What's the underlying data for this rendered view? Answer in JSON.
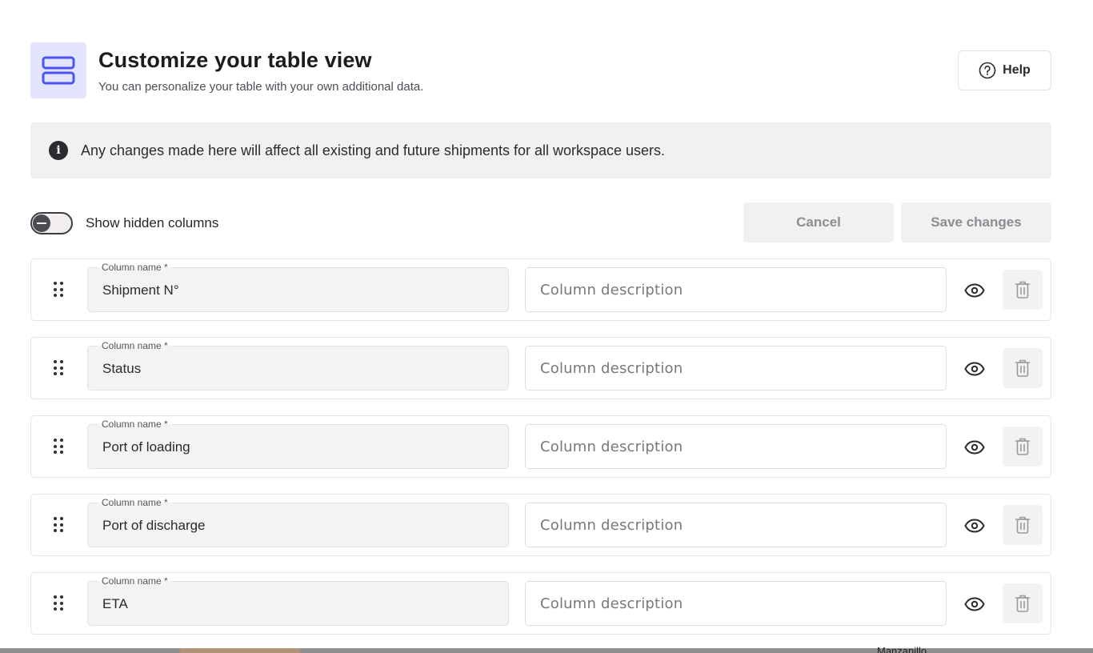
{
  "header": {
    "title": "Customize your table view",
    "subtitle": "You can personalize your table with your own additional data.",
    "icon": "table-rows-icon",
    "help_label": "Help"
  },
  "banner": {
    "icon": "info-icon",
    "icon_glyph": "i",
    "text": "Any changes made here will affect all existing and future shipments for all workspace users."
  },
  "toolbar": {
    "toggle_label": "Show hidden columns",
    "toggle_on": false,
    "cancel_label": "Cancel",
    "save_label": "Save changes"
  },
  "columns": [
    {
      "legend": "Column name *",
      "name": "Shipment N°",
      "description_placeholder": "Column description"
    },
    {
      "legend": "Column name *",
      "name": "Status",
      "description_placeholder": "Column description"
    },
    {
      "legend": "Column name *",
      "name": "Port of loading",
      "description_placeholder": "Column description"
    },
    {
      "legend": "Column name *",
      "name": "Port of discharge",
      "description_placeholder": "Column description"
    },
    {
      "legend": "Column name *",
      "name": "ETA",
      "description_placeholder": "Column description"
    }
  ],
  "background_peek": "Manzanillo",
  "colors": {
    "accent_icon_bg": "#e3e5ff",
    "accent_icon_stroke": "#4a52f0",
    "banner_bg": "#f2f0f0",
    "disabled_button_bg": "#f1f1f1"
  }
}
